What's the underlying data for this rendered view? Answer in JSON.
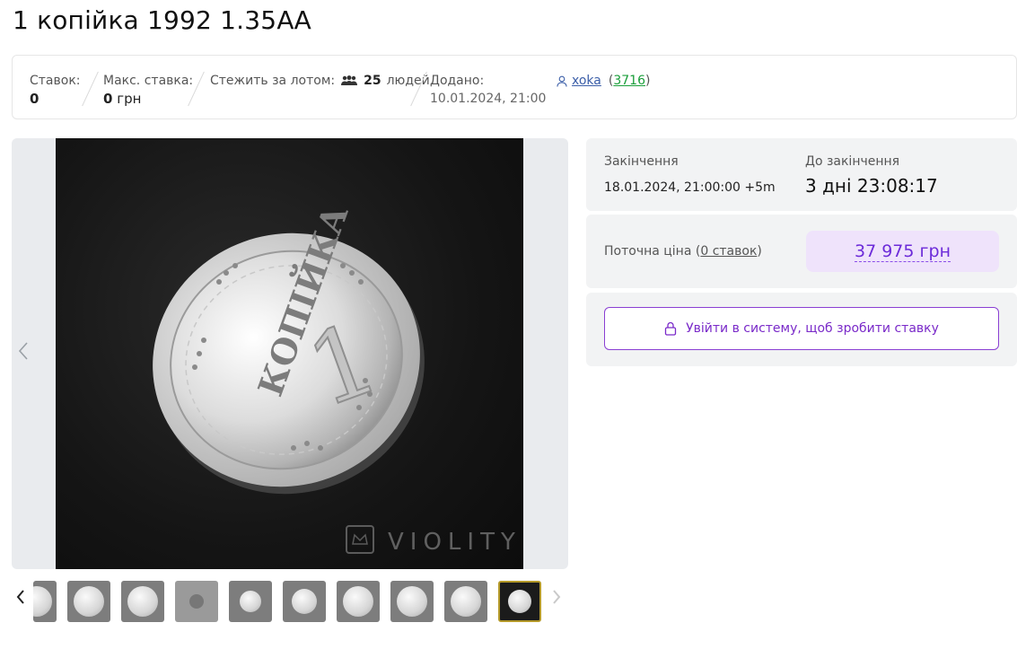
{
  "title": "1 копійка 1992 1.35АА",
  "stats": {
    "bids_label": "Ставок:",
    "bids_value": "0",
    "max_bid_label": "Макс. ставка:",
    "max_bid_value": "0",
    "max_bid_currency": "грн",
    "watch_label": "Стежить за лотом:",
    "watch_count": "25",
    "watch_unit": "людей",
    "added_label": "Додано:",
    "added_value": "10.01.2024, 21:00",
    "seller_name": "xoka",
    "seller_rating_open": "(",
    "seller_rating": "3716",
    "seller_rating_close": ")"
  },
  "gallery": {
    "watermark": "VIOLITY",
    "prev_icon": "chevron-left-icon",
    "thumb_count": 10,
    "active_thumb": 10
  },
  "auction": {
    "end_label": "Закінчення",
    "end_value": "18.01.2024, 21:00:00 +5m",
    "remaining_label": "До закінчення",
    "remaining_value": "3 дні 23:08:17",
    "price_label_start": "Поточна ціна (",
    "price_label_link": "0 ставок",
    "price_label_end": ")",
    "price_value": "37 975 грн",
    "login_button": "Увійти в систему, щоб зробити ставку"
  },
  "colors": {
    "accent": "#7a2ac9",
    "price_bg": "#efe3fb",
    "panel_bg": "#f2f3f4",
    "seller_link": "#3b5ea8",
    "rating_green": "#1a9e3a"
  }
}
